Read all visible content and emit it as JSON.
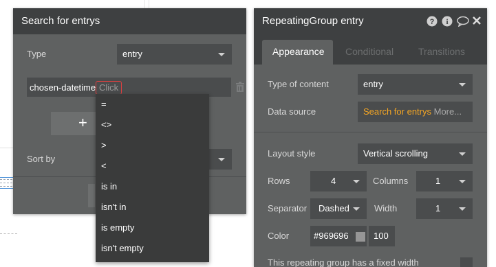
{
  "search_panel": {
    "title": "Search for entrys",
    "type_label": "Type",
    "type_value": "entry",
    "constraint_field": "chosen-datetime",
    "constraint_click": "Click",
    "add_label": "+",
    "sort_label": "Sort by"
  },
  "operator_menu": {
    "items": [
      "=",
      "<>",
      ">",
      "<",
      "is in",
      "isn't in",
      "is empty",
      "isn't empty"
    ]
  },
  "rg_panel": {
    "title": "RepeatingGroup entry",
    "tabs": [
      "Appearance",
      "Conditional",
      "Transitions"
    ],
    "type_of_content_label": "Type of content",
    "type_of_content_value": "entry",
    "data_source_label": "Data source",
    "data_source_value": "Search for entrys",
    "data_source_more": "More...",
    "layout_style_label": "Layout style",
    "layout_style_value": "Vertical scrolling",
    "rows_label": "Rows",
    "rows_value": "4",
    "columns_label": "Columns",
    "columns_value": "1",
    "separator_label": "Separator",
    "separator_value": "Dashed",
    "width_label": "Width",
    "width_value": "1",
    "color_label": "Color",
    "color_hex": "#969696",
    "color_opacity": "100",
    "fixed_width_label": "This repeating group has a fixed width"
  },
  "colors": {
    "panel_bg": "#5f6161",
    "header_bg": "#3e4041",
    "accent_orange": "#f5a623",
    "error_red": "#e04040"
  },
  "icons": [
    "help-icon",
    "info-icon",
    "comment-icon",
    "close-icon",
    "trash-icon",
    "plus-icon"
  ]
}
